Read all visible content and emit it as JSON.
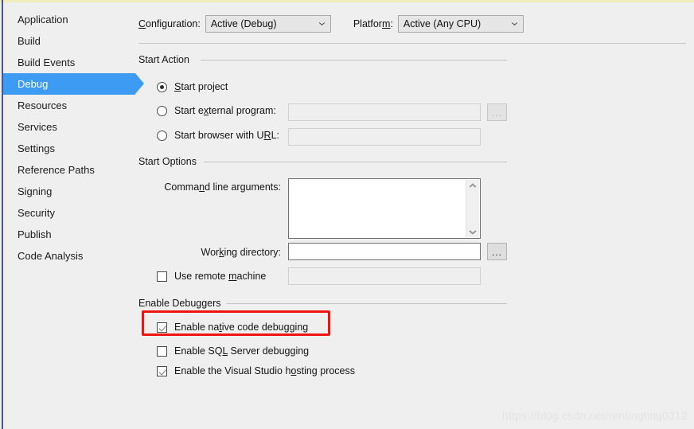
{
  "sidebar": {
    "items": [
      {
        "label": "Application",
        "selected": false
      },
      {
        "label": "Build",
        "selected": false
      },
      {
        "label": "Build Events",
        "selected": false
      },
      {
        "label": "Debug",
        "selected": true
      },
      {
        "label": "Resources",
        "selected": false
      },
      {
        "label": "Services",
        "selected": false
      },
      {
        "label": "Settings",
        "selected": false
      },
      {
        "label": "Reference Paths",
        "selected": false
      },
      {
        "label": "Signing",
        "selected": false
      },
      {
        "label": "Security",
        "selected": false
      },
      {
        "label": "Publish",
        "selected": false
      },
      {
        "label": "Code Analysis",
        "selected": false
      }
    ]
  },
  "toolbar": {
    "configuration_label": "Configuration:",
    "configuration_value": "Active (Debug)",
    "configuration_options": [
      "Active (Debug)"
    ],
    "platform_label": "Platform:",
    "platform_value": "Active (Any CPU)",
    "platform_options": [
      "Active (Any CPU)"
    ]
  },
  "start_action": {
    "title": "Start Action",
    "options": [
      {
        "label": "Start project",
        "selected": true
      },
      {
        "label": "Start external program:",
        "selected": false
      },
      {
        "label": "Start browser with URL:",
        "selected": false
      }
    ],
    "external_program_value": "",
    "browser_url_value": "",
    "browse_label": "..."
  },
  "start_options": {
    "title": "Start Options",
    "command_line_label": "Command line arguments:",
    "command_line_value": "",
    "working_directory_label": "Working directory:",
    "working_directory_value": "",
    "working_directory_browse_label": "...",
    "use_remote_machine_label": "Use remote machine",
    "use_remote_machine_checked": false,
    "remote_machine_value": ""
  },
  "enable_debuggers": {
    "title": "Enable Debuggers",
    "items": [
      {
        "label": "Enable native code debugging",
        "checked": true,
        "highlighted": true
      },
      {
        "label": "Enable SQL Server debugging",
        "checked": false,
        "highlighted": false
      },
      {
        "label": "Enable the Visual Studio hosting process",
        "checked": true,
        "highlighted": false
      }
    ]
  },
  "watermark": {
    "text": "https://blog.csdn.net/rentingting0312"
  },
  "colors": {
    "selection": "#3e9bf4",
    "highlight": "#ee1410",
    "background": "#efefef",
    "top_rule": "#f2edbc",
    "left_rule": "#49568a"
  }
}
